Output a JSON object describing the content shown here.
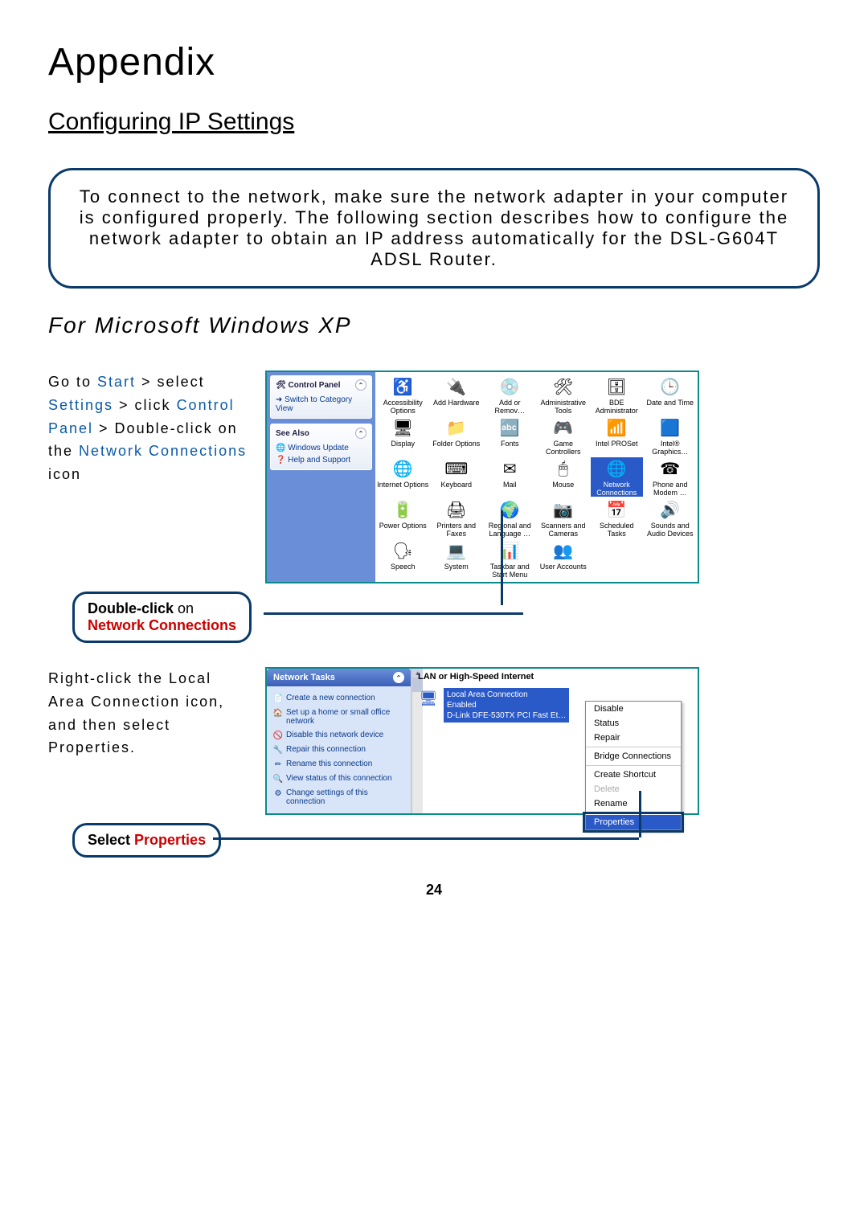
{
  "heading": "Appendix",
  "subheading": "Configuring IP Settings",
  "intro": "To connect to the network, make sure the network adapter in your computer is configured properly. The following section describes how to configure the network adapter to obtain an IP address automatically for the DSL-G604T ADSL Router.",
  "os_heading": "For Microsoft Windows XP",
  "step1": {
    "p1": "Go to ",
    "start": "Start",
    "p2": " > select ",
    "settings": "Settings",
    "p3": " > click ",
    "cp": "Control Panel",
    "p4": " > Double-click on the ",
    "nc": "Network Connections",
    "p5": " icon"
  },
  "callout1": {
    "a": "Double-click",
    "b": " on",
    "c": "Network Connections"
  },
  "step2": "Right-click the Local Area Connection icon, and then select Properties.",
  "callout2": {
    "a": "Select ",
    "b": "Properties"
  },
  "cp_side": {
    "title": "Control Panel",
    "switch": "Switch to Category View",
    "see_also": "See Also",
    "wu": "Windows Update",
    "hs": "Help and Support"
  },
  "cp_items": [
    "Accessibility Options",
    "Add Hardware",
    "Add or Remov…",
    "Administrative Tools",
    "BDE Administrator",
    "Date and Time",
    "Display",
    "Folder Options",
    "Fonts",
    "Game Controllers",
    "Intel PROSet",
    "Intel® Graphics…",
    "Internet Options",
    "Keyboard",
    "Mail",
    "Mouse",
    "Network Connections",
    "Phone and Modem …",
    "Power Options",
    "Printers and Faxes",
    "Regional and Language …",
    "Scanners and Cameras",
    "Scheduled Tasks",
    "Sounds and Audio Devices",
    "Speech",
    "System",
    "Taskbar and Start Menu",
    "User Accounts"
  ],
  "nt": {
    "title": "Network Tasks",
    "items": [
      "Create a new connection",
      "Set up a home or small office network",
      "Disable this network device",
      "Repair this connection",
      "Rename this connection",
      "View status of this connection",
      "Change settings of this connection"
    ]
  },
  "lan_header": "LAN or High-Speed Internet",
  "conn": {
    "name": "Local Area Connection",
    "status": "Enabled",
    "dev": "D-Link DFE-530TX PCI Fast Et…"
  },
  "ctx": [
    "Disable",
    "Status",
    "Repair",
    "|",
    "Bridge Connections",
    "|",
    "Create Shortcut",
    "~Delete",
    "Rename",
    "|",
    "*Properties"
  ],
  "page": "24"
}
